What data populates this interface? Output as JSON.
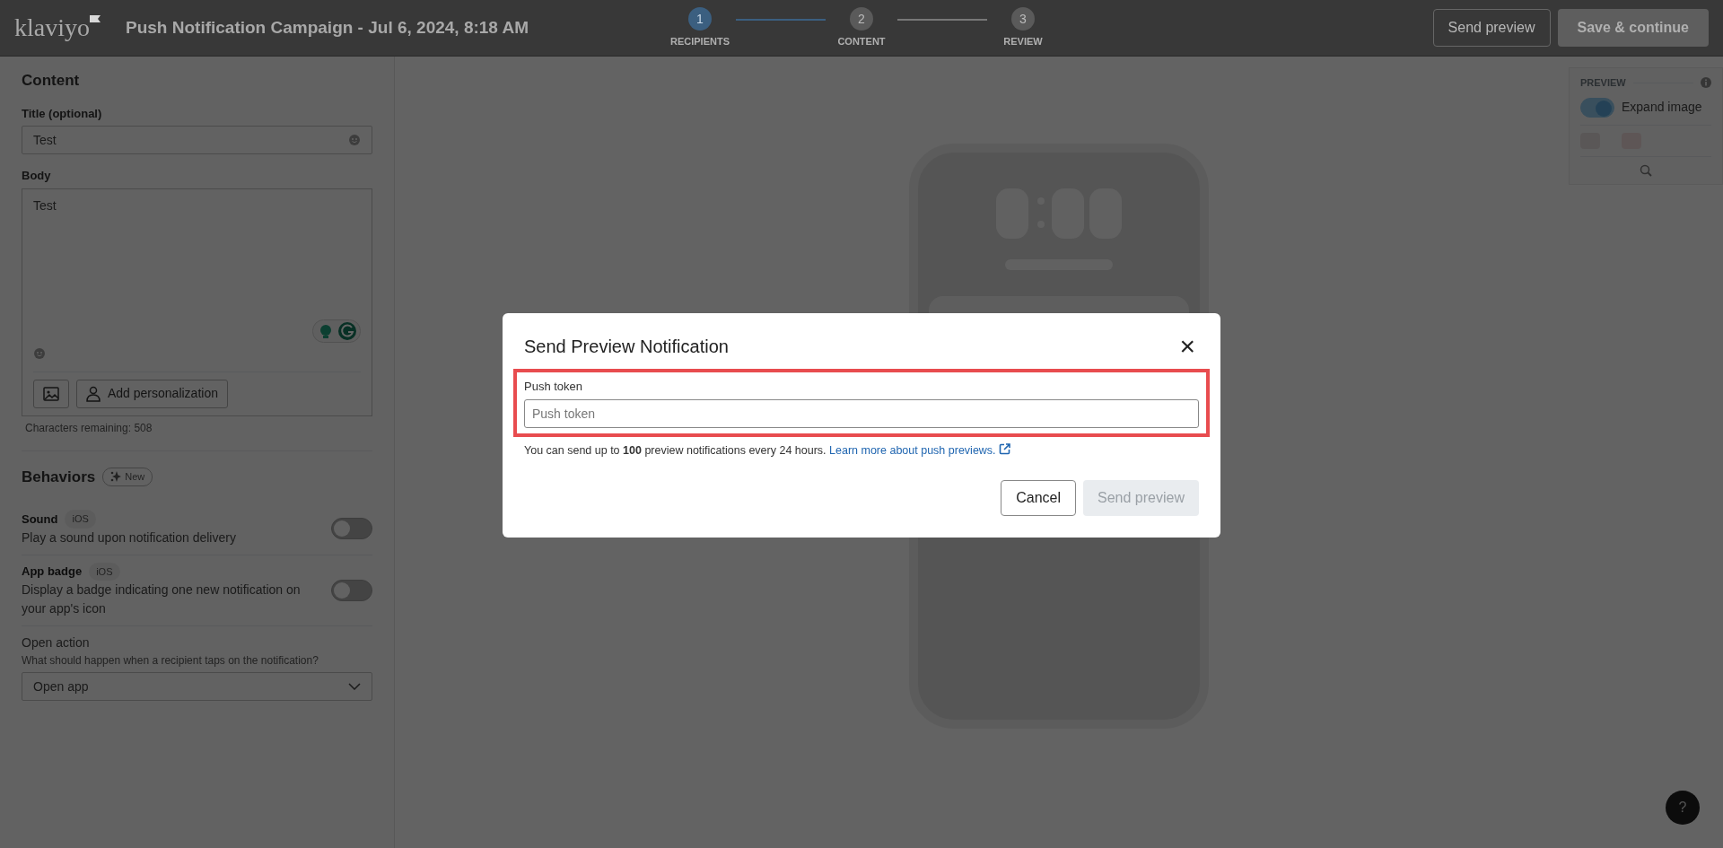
{
  "header": {
    "logo": "klaviyo",
    "title": "Push Notification Campaign - Jul 6, 2024, 8:18 AM",
    "steps": [
      {
        "number": "1",
        "label": "RECIPIENTS",
        "selected": true
      },
      {
        "number": "2",
        "label": "CONTENT",
        "selected": false
      },
      {
        "number": "3",
        "label": "REVIEW",
        "selected": false
      }
    ],
    "buttons": {
      "send_preview": "Send preview",
      "save_continue": "Save & continue"
    }
  },
  "content": {
    "heading": "Content",
    "title_field": {
      "label": "Title (optional)",
      "value": "Test"
    },
    "body_field": {
      "label": "Body",
      "value": "Test"
    },
    "personalization_button": "Add personalization",
    "characters_remaining": "Characters remaining: 508"
  },
  "behaviors": {
    "heading": "Behaviors",
    "badge": "New",
    "items": [
      {
        "title": "Sound",
        "tag": "iOS",
        "description": "Play a sound upon notification delivery",
        "on": false
      },
      {
        "title": "App badge",
        "tag": "iOS",
        "description": "Display a badge indicating one new notification on your app's icon",
        "on": false
      }
    ],
    "open_action": {
      "label": "Open action",
      "hint": "What should happen when a recipient taps on the notification?",
      "value": "Open app"
    }
  },
  "preview": {
    "heading": "PREVIEW",
    "expand_image": {
      "label": "Expand image",
      "on": true
    }
  },
  "help_button": "?",
  "dialog": {
    "title": "Send Preview Notification",
    "close": "×",
    "field": {
      "label": "Push token",
      "placeholder": "Push token"
    },
    "note": "You can send up to **100** preview notifications every 24 hours.",
    "link": "Learn more about push previews.",
    "buttons": [
      {
        "kind": "secondary",
        "label": "Cancel",
        "disabled": false
      },
      {
        "kind": "primary",
        "label": "Send preview",
        "disabled": true
      }
    ]
  }
}
